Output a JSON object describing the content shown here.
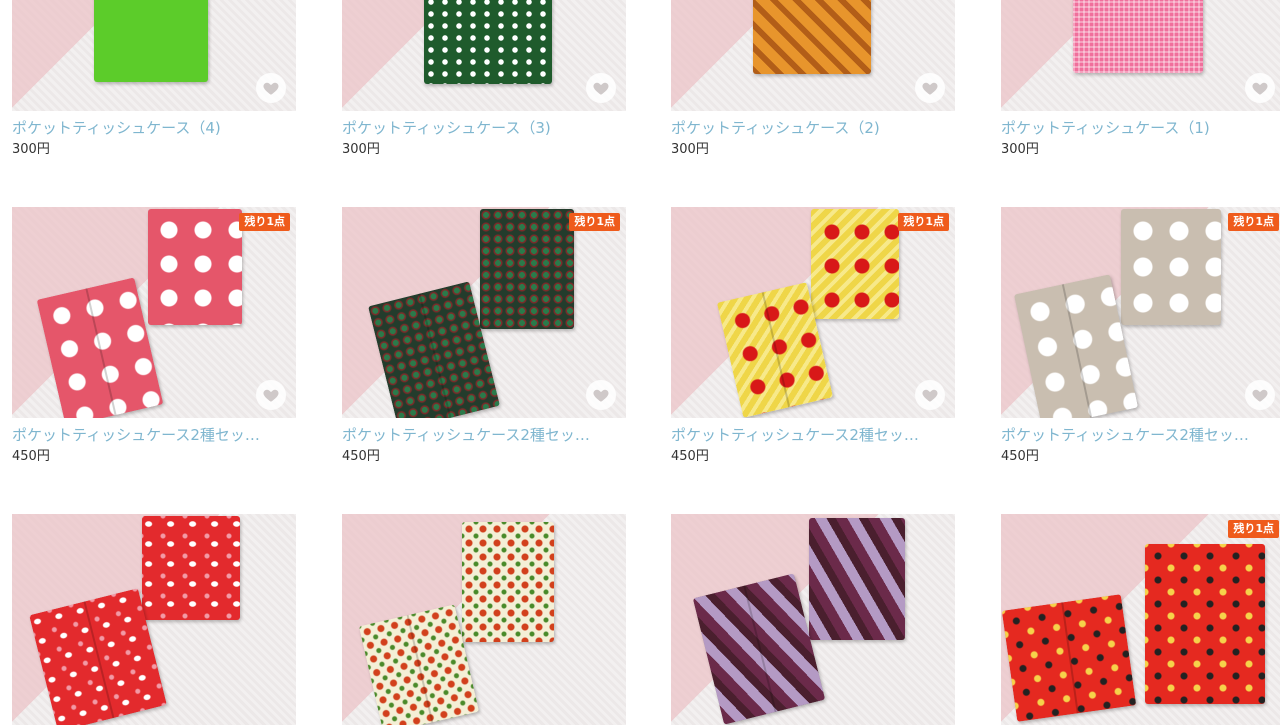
{
  "products": [
    {
      "title": "ポケットティッシュケース（4)",
      "price": "300円",
      "badge": ""
    },
    {
      "title": "ポケットティッシュケース（3)",
      "price": "300円",
      "badge": ""
    },
    {
      "title": "ポケットティッシュケース（2)",
      "price": "300円",
      "badge": ""
    },
    {
      "title": "ポケットティッシュケース（1)",
      "price": "300円",
      "badge": ""
    },
    {
      "title": "ポケットティッシュケース2種セッ…",
      "price": "450円",
      "badge": "残り1点"
    },
    {
      "title": "ポケットティッシュケース2種セッ…",
      "price": "450円",
      "badge": "残り1点"
    },
    {
      "title": "ポケットティッシュケース2種セッ…",
      "price": "450円",
      "badge": "残り1点"
    },
    {
      "title": "ポケットティッシュケース2種セッ…",
      "price": "450円",
      "badge": "残り1点"
    },
    {
      "title": "",
      "price": "",
      "badge": ""
    },
    {
      "title": "",
      "price": "",
      "badge": ""
    },
    {
      "title": "",
      "price": "",
      "badge": ""
    },
    {
      "title": "",
      "price": "",
      "badge": "残り1点"
    }
  ],
  "icons": {
    "favorite": "heart-icon"
  },
  "colors": {
    "title_link": "#7fb6cf",
    "badge_bg": "#ef5b1c",
    "price_text": "#333333"
  }
}
